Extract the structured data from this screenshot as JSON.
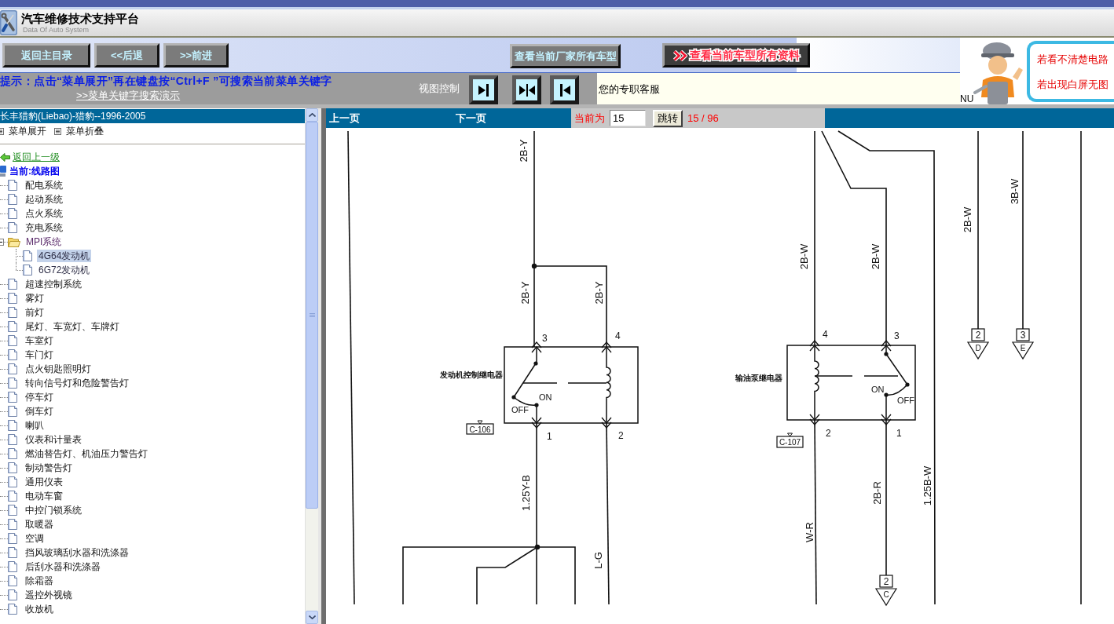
{
  "header": {
    "title": "汽车维修技术支持平台",
    "subtitle": "Data Of Auto System"
  },
  "toolbar": {
    "nav_buttons": [
      "返回主目录",
      "<<后退",
      ">>前进"
    ],
    "catalog_buttons": [
      {
        "label": "查看当前厂家所有车型",
        "kind": "plain"
      },
      {
        "label": "查看当前车型所有资料",
        "kind": "highlight"
      }
    ]
  },
  "hint": {
    "text": "提示：点击“菜单展开”再在键盘按“Ctrl+F ”可搜索当前菜单关键字",
    "link": ">>菜单关键字搜索演示"
  },
  "view_control": {
    "label": "视图控制",
    "buttons": [
      {
        "kind": "step_right"
      },
      {
        "kind": "fit"
      },
      {
        "kind": "step_left"
      }
    ]
  },
  "service": {
    "text": "您的专职客服"
  },
  "notice": {
    "caption": "NU",
    "lines": [
      "若看不清楚电路",
      "若出现白屏无图"
    ]
  },
  "sidebar": {
    "title": "长丰猎豹(Liebao)-猎豹--1996-2005",
    "actions": [
      "菜单展开",
      "菜单折叠"
    ],
    "back_link": "返回上一级",
    "current": "当前:线路图",
    "tree": [
      {
        "label": "配电系统",
        "kind": "page",
        "selected": false
      },
      {
        "label": "起动系统",
        "kind": "page",
        "selected": false
      },
      {
        "label": "点火系统",
        "kind": "page",
        "selected": false
      },
      {
        "label": "充电系统",
        "kind": "page",
        "selected": false
      },
      {
        "label": "MPI系统",
        "kind": "folder",
        "expanded": true,
        "selected": false,
        "children": [
          {
            "label": "4G64发动机",
            "kind": "page",
            "selected": true
          },
          {
            "label": "6G72发动机",
            "kind": "page",
            "selected": false
          }
        ]
      },
      {
        "label": "超速控制系统",
        "kind": "page",
        "selected": false
      },
      {
        "label": "雾灯",
        "kind": "page",
        "selected": false
      },
      {
        "label": "前灯",
        "kind": "page",
        "selected": false
      },
      {
        "label": "尾灯、车宽灯、车牌灯",
        "kind": "page",
        "selected": false
      },
      {
        "label": "车室灯",
        "kind": "page",
        "selected": false
      },
      {
        "label": "车门灯",
        "kind": "page",
        "selected": false
      },
      {
        "label": "点火钥匙照明灯",
        "kind": "page",
        "selected": false
      },
      {
        "label": "转向信号灯和危险警告灯",
        "kind": "page",
        "selected": false
      },
      {
        "label": "停车灯",
        "kind": "page",
        "selected": false
      },
      {
        "label": "倒车灯",
        "kind": "page",
        "selected": false
      },
      {
        "label": "喇叭",
        "kind": "page",
        "selected": false
      },
      {
        "label": "仪表和计量表",
        "kind": "page",
        "selected": false
      },
      {
        "label": "燃油替告灯、机油压力警告灯",
        "kind": "page",
        "selected": false
      },
      {
        "label": "制动警告灯",
        "kind": "page",
        "selected": false
      },
      {
        "label": "通用仪表",
        "kind": "page",
        "selected": false
      },
      {
        "label": "电动车窗",
        "kind": "page",
        "selected": false
      },
      {
        "label": "中控门锁系统",
        "kind": "page",
        "selected": false
      },
      {
        "label": "取暖器",
        "kind": "page",
        "selected": false
      },
      {
        "label": "空调",
        "kind": "page",
        "selected": false
      },
      {
        "label": "挡风玻璃刮水器和洗涤器",
        "kind": "page",
        "selected": false
      },
      {
        "label": "后刮水器和洗涤器",
        "kind": "page",
        "selected": false
      },
      {
        "label": "除霜器",
        "kind": "page",
        "selected": false
      },
      {
        "label": "遥控外视镜",
        "kind": "page",
        "selected": false
      },
      {
        "label": "收放机",
        "kind": "page",
        "selected": false
      }
    ]
  },
  "pager": {
    "prev": "上一页",
    "next": "下一页",
    "current_label": "当前为",
    "page_value": "15",
    "go_button": "跳转",
    "page_count": "15 / 96"
  },
  "diagram": {
    "wire_labels": [
      "2B-Y",
      "2B-Y",
      "2B-Y",
      "1.25Y-B",
      "L-G",
      "2B-W",
      "2B-W",
      "2B-R",
      "W-R",
      "1.25B-W",
      "2B-W",
      "3B-W"
    ],
    "relays": [
      {
        "name": "发动机控制继电器",
        "connector": "C-106",
        "pins": [
          "3",
          "4",
          "1",
          "2"
        ],
        "on_label": "ON",
        "off_label": "OFF"
      },
      {
        "name": "输油泵继电器",
        "connector": "C-107",
        "pins": [
          "4",
          "3",
          "2",
          "1"
        ],
        "on_label": "ON",
        "off_label": "OFF"
      }
    ],
    "terminals": [
      {
        "number": "2",
        "letter": "C"
      },
      {
        "number": "2",
        "letter": "D"
      },
      {
        "number": "3",
        "letter": "E"
      }
    ]
  }
}
